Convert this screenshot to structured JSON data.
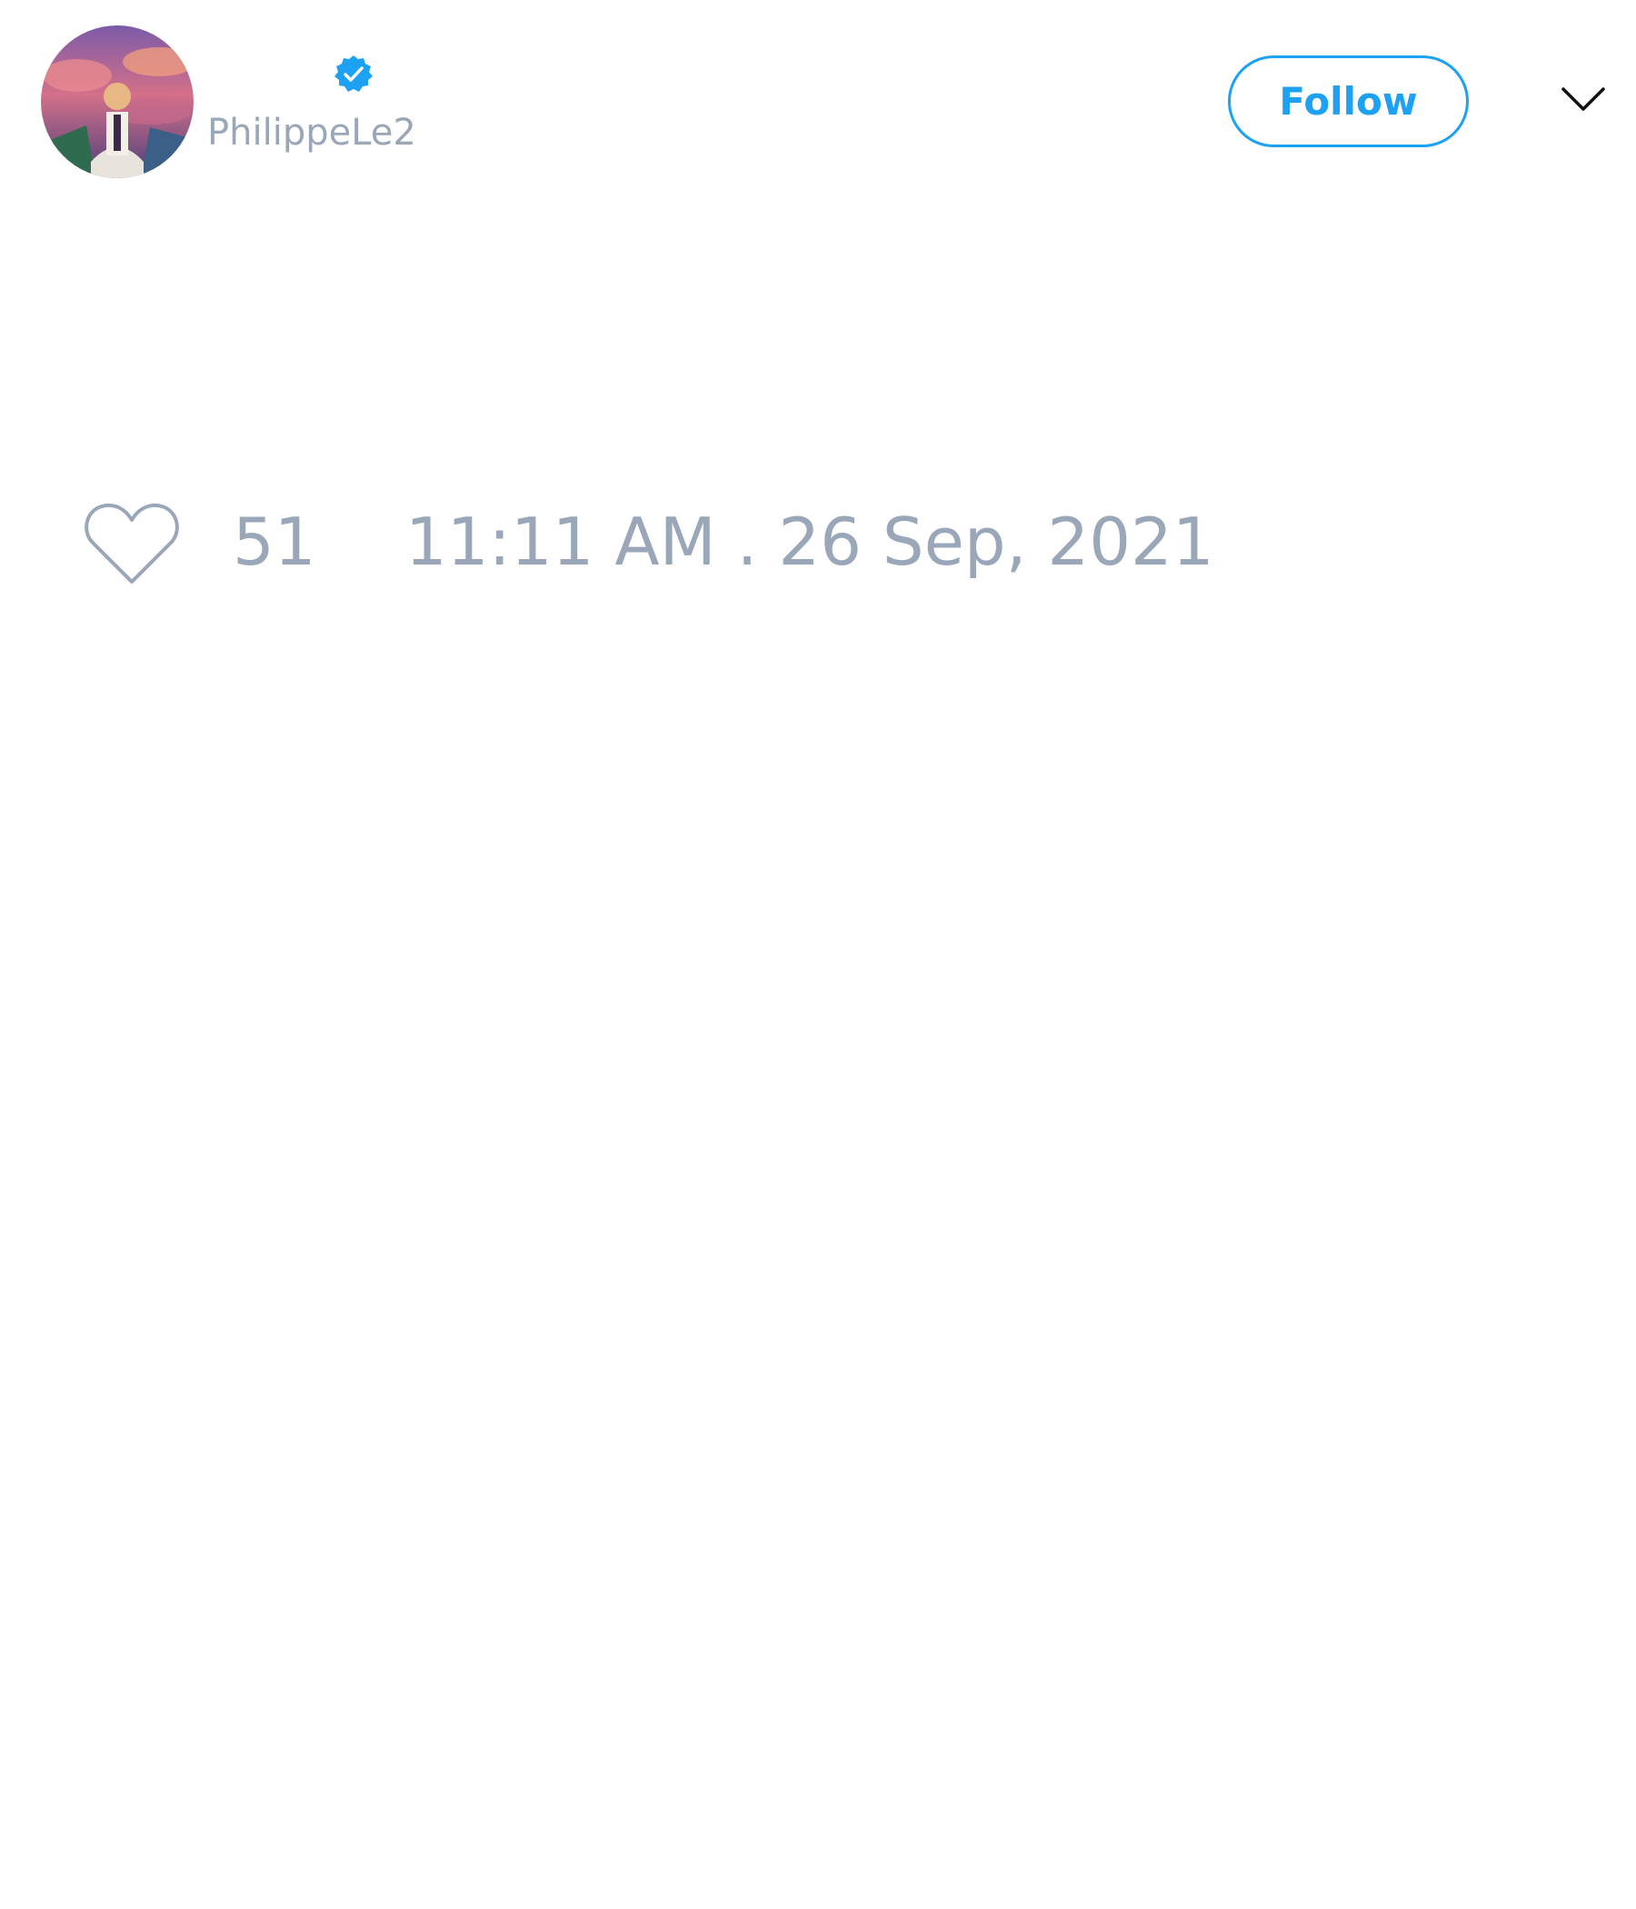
{
  "tweet": {
    "author": {
      "display_name": "",
      "handle": "PhilippeLe2",
      "verified": true,
      "avatar_icon": "avatar-image",
      "verified_icon": "verified-badge-icon"
    },
    "follow_button": {
      "label": "Follow"
    },
    "menu_icon": "chevron-down-icon",
    "like_icon": "heart-outline-icon",
    "like_count": "51",
    "timestamp": "11:11 AM . 26 Sep, 2021"
  },
  "colors": {
    "accent": "#1da1f2",
    "muted_text": "#9aa7b8",
    "background": "#ffffff"
  }
}
